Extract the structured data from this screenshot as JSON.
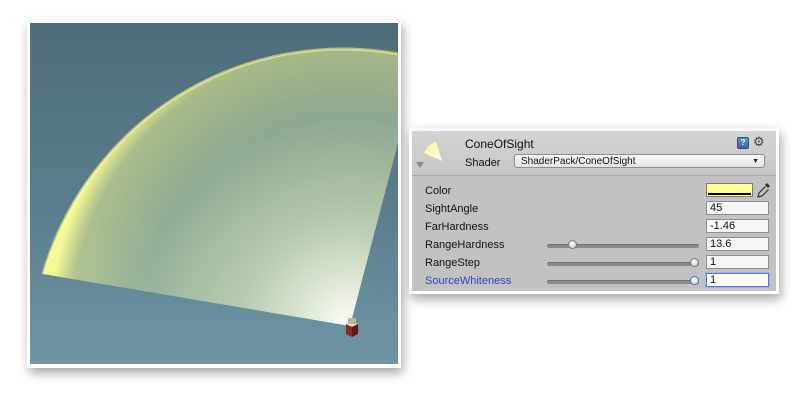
{
  "colors": {
    "cone_color": "#ffff96",
    "scene_background": "#557584",
    "active_label": "#2e43c8"
  },
  "material": {
    "name": "ConeOfSight",
    "shader_label": "Shader",
    "shader_value": "ShaderPack/ConeOfSight",
    "icons": [
      "material-thumbnail-icon",
      "foldout-arrow-icon",
      "help-book-icon",
      "gear-icon"
    ]
  },
  "properties": {
    "color": {
      "label": "Color",
      "value_hex": "#ffff96",
      "icon": "eyedropper-icon"
    },
    "sight_angle": {
      "label": "SightAngle",
      "value": "45"
    },
    "far_hardness": {
      "label": "FarHardness",
      "value": "-1.46"
    },
    "range_hardness": {
      "label": "RangeHardness",
      "value": "13.6",
      "slider_fraction": 0.15
    },
    "range_step": {
      "label": "RangeStep",
      "value": "1",
      "slider_fraction": 1.0
    },
    "source_whiteness": {
      "label": "SourceWhiteness",
      "value": "1",
      "slider_fraction": 1.0
    }
  }
}
